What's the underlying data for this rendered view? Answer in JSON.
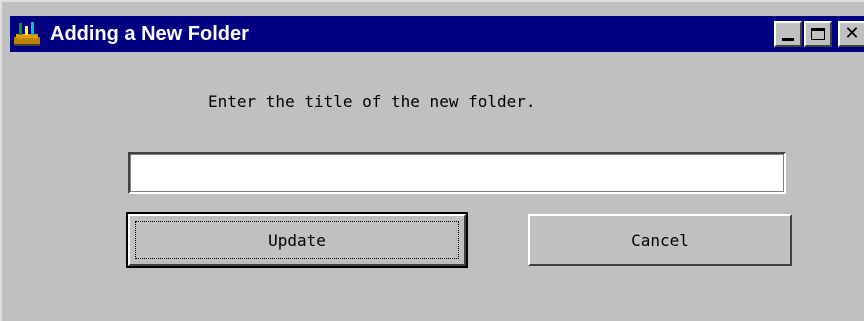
{
  "window": {
    "title": "Adding a New Folder",
    "icon": "app-folder-icon"
  },
  "titlebar_buttons": {
    "minimize": "minimize-icon",
    "maximize": "maximize-icon",
    "close": "close-icon"
  },
  "dialog": {
    "prompt": "Enter the title of the new folder.",
    "input_value": "",
    "input_placeholder": "",
    "update_label": "Update",
    "cancel_label": "Cancel"
  },
  "colors": {
    "titlebar": "#000080",
    "face": "#c0c0c0"
  }
}
